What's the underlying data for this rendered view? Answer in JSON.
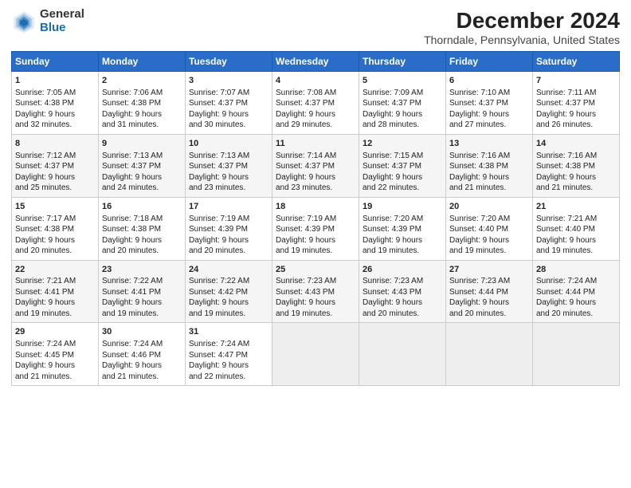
{
  "header": {
    "logo_general": "General",
    "logo_blue": "Blue",
    "title": "December 2024",
    "subtitle": "Thorndale, Pennsylvania, United States"
  },
  "columns": [
    "Sunday",
    "Monday",
    "Tuesday",
    "Wednesday",
    "Thursday",
    "Friday",
    "Saturday"
  ],
  "weeks": [
    [
      {
        "day": "1",
        "lines": [
          "Sunrise: 7:05 AM",
          "Sunset: 4:38 PM",
          "Daylight: 9 hours",
          "and 32 minutes."
        ]
      },
      {
        "day": "2",
        "lines": [
          "Sunrise: 7:06 AM",
          "Sunset: 4:38 PM",
          "Daylight: 9 hours",
          "and 31 minutes."
        ]
      },
      {
        "day": "3",
        "lines": [
          "Sunrise: 7:07 AM",
          "Sunset: 4:37 PM",
          "Daylight: 9 hours",
          "and 30 minutes."
        ]
      },
      {
        "day": "4",
        "lines": [
          "Sunrise: 7:08 AM",
          "Sunset: 4:37 PM",
          "Daylight: 9 hours",
          "and 29 minutes."
        ]
      },
      {
        "day": "5",
        "lines": [
          "Sunrise: 7:09 AM",
          "Sunset: 4:37 PM",
          "Daylight: 9 hours",
          "and 28 minutes."
        ]
      },
      {
        "day": "6",
        "lines": [
          "Sunrise: 7:10 AM",
          "Sunset: 4:37 PM",
          "Daylight: 9 hours",
          "and 27 minutes."
        ]
      },
      {
        "day": "7",
        "lines": [
          "Sunrise: 7:11 AM",
          "Sunset: 4:37 PM",
          "Daylight: 9 hours",
          "and 26 minutes."
        ]
      }
    ],
    [
      {
        "day": "8",
        "lines": [
          "Sunrise: 7:12 AM",
          "Sunset: 4:37 PM",
          "Daylight: 9 hours",
          "and 25 minutes."
        ]
      },
      {
        "day": "9",
        "lines": [
          "Sunrise: 7:13 AM",
          "Sunset: 4:37 PM",
          "Daylight: 9 hours",
          "and 24 minutes."
        ]
      },
      {
        "day": "10",
        "lines": [
          "Sunrise: 7:13 AM",
          "Sunset: 4:37 PM",
          "Daylight: 9 hours",
          "and 23 minutes."
        ]
      },
      {
        "day": "11",
        "lines": [
          "Sunrise: 7:14 AM",
          "Sunset: 4:37 PM",
          "Daylight: 9 hours",
          "and 23 minutes."
        ]
      },
      {
        "day": "12",
        "lines": [
          "Sunrise: 7:15 AM",
          "Sunset: 4:37 PM",
          "Daylight: 9 hours",
          "and 22 minutes."
        ]
      },
      {
        "day": "13",
        "lines": [
          "Sunrise: 7:16 AM",
          "Sunset: 4:38 PM",
          "Daylight: 9 hours",
          "and 21 minutes."
        ]
      },
      {
        "day": "14",
        "lines": [
          "Sunrise: 7:16 AM",
          "Sunset: 4:38 PM",
          "Daylight: 9 hours",
          "and 21 minutes."
        ]
      }
    ],
    [
      {
        "day": "15",
        "lines": [
          "Sunrise: 7:17 AM",
          "Sunset: 4:38 PM",
          "Daylight: 9 hours",
          "and 20 minutes."
        ]
      },
      {
        "day": "16",
        "lines": [
          "Sunrise: 7:18 AM",
          "Sunset: 4:38 PM",
          "Daylight: 9 hours",
          "and 20 minutes."
        ]
      },
      {
        "day": "17",
        "lines": [
          "Sunrise: 7:19 AM",
          "Sunset: 4:39 PM",
          "Daylight: 9 hours",
          "and 20 minutes."
        ]
      },
      {
        "day": "18",
        "lines": [
          "Sunrise: 7:19 AM",
          "Sunset: 4:39 PM",
          "Daylight: 9 hours",
          "and 19 minutes."
        ]
      },
      {
        "day": "19",
        "lines": [
          "Sunrise: 7:20 AM",
          "Sunset: 4:39 PM",
          "Daylight: 9 hours",
          "and 19 minutes."
        ]
      },
      {
        "day": "20",
        "lines": [
          "Sunrise: 7:20 AM",
          "Sunset: 4:40 PM",
          "Daylight: 9 hours",
          "and 19 minutes."
        ]
      },
      {
        "day": "21",
        "lines": [
          "Sunrise: 7:21 AM",
          "Sunset: 4:40 PM",
          "Daylight: 9 hours",
          "and 19 minutes."
        ]
      }
    ],
    [
      {
        "day": "22",
        "lines": [
          "Sunrise: 7:21 AM",
          "Sunset: 4:41 PM",
          "Daylight: 9 hours",
          "and 19 minutes."
        ]
      },
      {
        "day": "23",
        "lines": [
          "Sunrise: 7:22 AM",
          "Sunset: 4:41 PM",
          "Daylight: 9 hours",
          "and 19 minutes."
        ]
      },
      {
        "day": "24",
        "lines": [
          "Sunrise: 7:22 AM",
          "Sunset: 4:42 PM",
          "Daylight: 9 hours",
          "and 19 minutes."
        ]
      },
      {
        "day": "25",
        "lines": [
          "Sunrise: 7:23 AM",
          "Sunset: 4:43 PM",
          "Daylight: 9 hours",
          "and 19 minutes."
        ]
      },
      {
        "day": "26",
        "lines": [
          "Sunrise: 7:23 AM",
          "Sunset: 4:43 PM",
          "Daylight: 9 hours",
          "and 20 minutes."
        ]
      },
      {
        "day": "27",
        "lines": [
          "Sunrise: 7:23 AM",
          "Sunset: 4:44 PM",
          "Daylight: 9 hours",
          "and 20 minutes."
        ]
      },
      {
        "day": "28",
        "lines": [
          "Sunrise: 7:24 AM",
          "Sunset: 4:44 PM",
          "Daylight: 9 hours",
          "and 20 minutes."
        ]
      }
    ],
    [
      {
        "day": "29",
        "lines": [
          "Sunrise: 7:24 AM",
          "Sunset: 4:45 PM",
          "Daylight: 9 hours",
          "and 21 minutes."
        ]
      },
      {
        "day": "30",
        "lines": [
          "Sunrise: 7:24 AM",
          "Sunset: 4:46 PM",
          "Daylight: 9 hours",
          "and 21 minutes."
        ]
      },
      {
        "day": "31",
        "lines": [
          "Sunrise: 7:24 AM",
          "Sunset: 4:47 PM",
          "Daylight: 9 hours",
          "and 22 minutes."
        ]
      },
      {
        "day": "",
        "lines": []
      },
      {
        "day": "",
        "lines": []
      },
      {
        "day": "",
        "lines": []
      },
      {
        "day": "",
        "lines": []
      }
    ]
  ]
}
